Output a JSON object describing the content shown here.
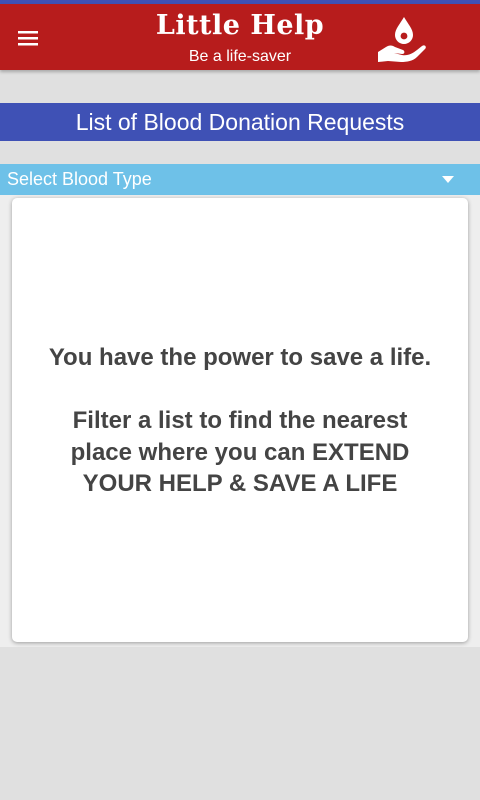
{
  "app_bar": {
    "title": "Little Help",
    "subtitle": "Be a life-saver",
    "menu_icon": "hamburger-menu-icon",
    "logo_icon": "blood-drop-hand-icon"
  },
  "section": {
    "title": "List of Blood Donation Requests"
  },
  "blood_type_select": {
    "placeholder": "Select Blood Type",
    "icon": "dropdown-arrow-icon"
  },
  "card": {
    "headline": "You have the power to save a life.",
    "message_lines": [
      "Filter a list to find the nearest",
      "place where you can EXTEND",
      "YOUR HELP & SAVE A LIFE"
    ]
  },
  "colors": {
    "app_bar": "#b71c1c",
    "section_bar": "#3f51b5",
    "select_bar": "#6ec1e8",
    "background": "#e0e0e0"
  }
}
